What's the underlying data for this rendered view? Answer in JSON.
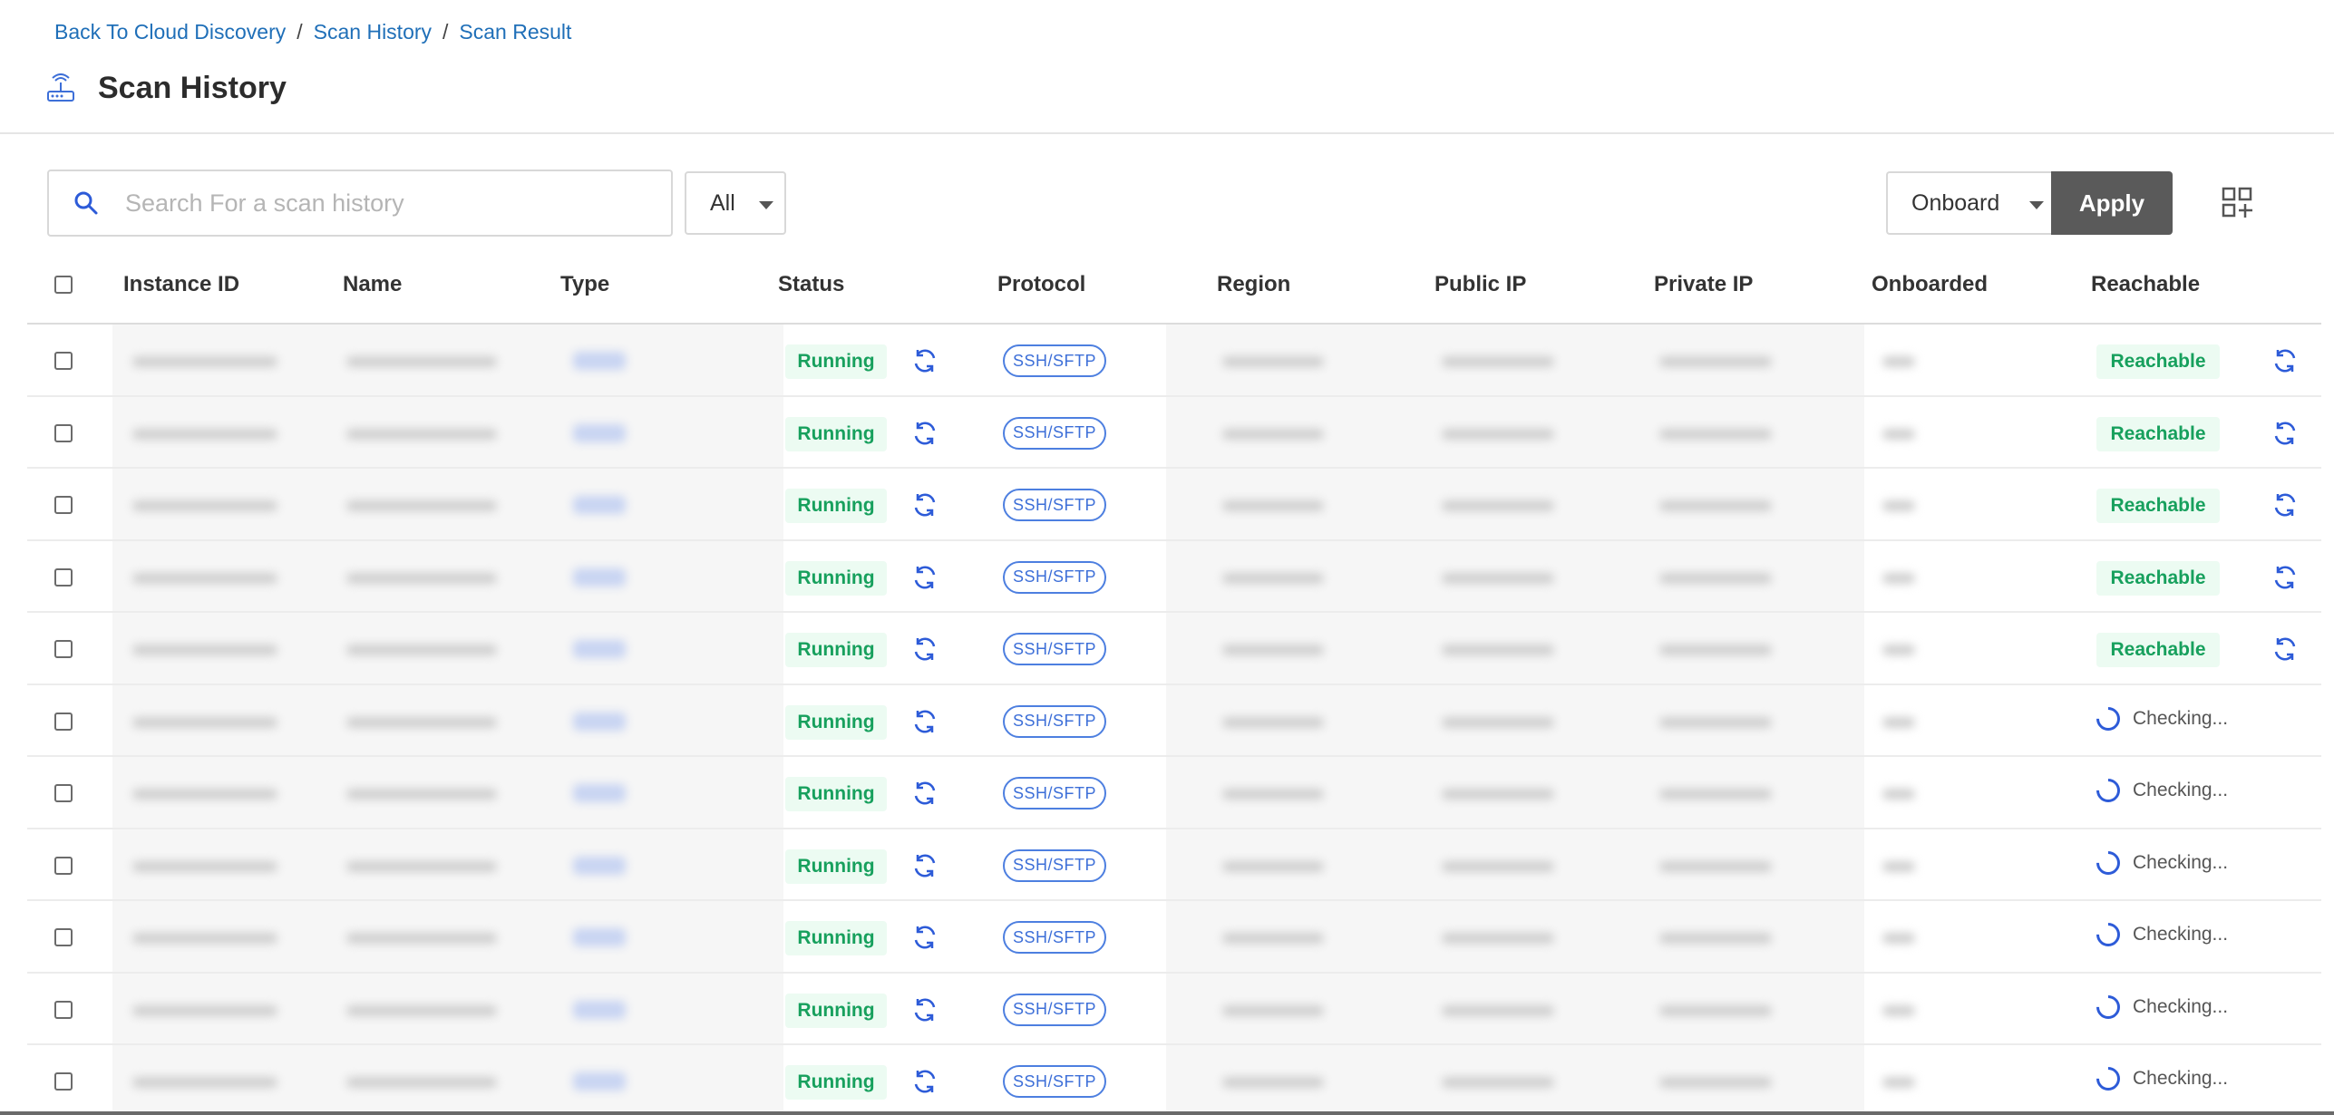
{
  "breadcrumb": {
    "items": [
      "Back To Cloud Discovery",
      "Scan History",
      "Scan Result"
    ],
    "separator": "/"
  },
  "header": {
    "title": "Scan History",
    "icon": "router-icon"
  },
  "toolbar": {
    "search_placeholder": "Search For a scan history",
    "search_value": "",
    "filter_value": "All",
    "action_value": "Onboard",
    "apply_label": "Apply",
    "grid_icon": "grid-add-icon"
  },
  "table": {
    "columns": [
      "Instance ID",
      "Name",
      "Type",
      "Status",
      "Protocol",
      "Region",
      "Public IP",
      "Private IP",
      "Onboarded",
      "Reachable"
    ],
    "rows": [
      {
        "status": "Running",
        "protocol": "SSH/SFTP",
        "reachable": "Reachable"
      },
      {
        "status": "Running",
        "protocol": "SSH/SFTP",
        "reachable": "Reachable"
      },
      {
        "status": "Running",
        "protocol": "SSH/SFTP",
        "reachable": "Reachable"
      },
      {
        "status": "Running",
        "protocol": "SSH/SFTP",
        "reachable": "Reachable"
      },
      {
        "status": "Running",
        "protocol": "SSH/SFTP",
        "reachable": "Reachable"
      },
      {
        "status": "Running",
        "protocol": "SSH/SFTP",
        "reachable": "Checking..."
      },
      {
        "status": "Running",
        "protocol": "SSH/SFTP",
        "reachable": "Checking..."
      },
      {
        "status": "Running",
        "protocol": "SSH/SFTP",
        "reachable": "Checking..."
      },
      {
        "status": "Running",
        "protocol": "SSH/SFTP",
        "reachable": "Checking..."
      },
      {
        "status": "Running",
        "protocol": "SSH/SFTP",
        "reachable": "Checking..."
      },
      {
        "status": "Running",
        "protocol": "SSH/SFTP",
        "reachable": "Checking..."
      }
    ]
  },
  "colors": {
    "link": "#1f6fb8",
    "status_green": "#17a05d",
    "status_bg": "#ecfbf2",
    "protocol_blue": "#3d6fd8",
    "apply_bg": "#5a5a5a"
  }
}
